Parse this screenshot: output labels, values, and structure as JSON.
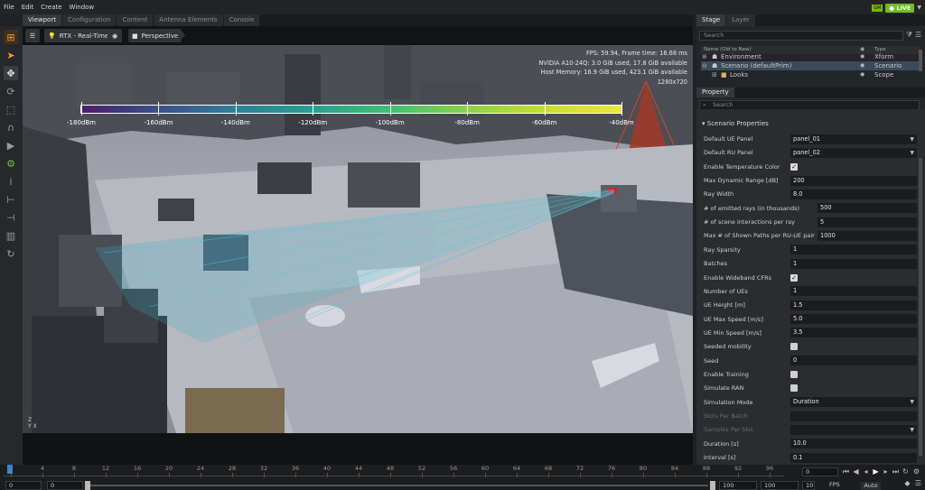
{
  "menu": [
    "File",
    "Edit",
    "Create",
    "Window"
  ],
  "live_label": "LIVE",
  "nvidia_badge": "GM",
  "viewport_tabs": [
    "Viewport",
    "Configuration",
    "Content",
    "Antenna Elements",
    "Console"
  ],
  "viewport_toolbar": {
    "renderer": "RTX - Real-Time",
    "camera": "Perspective"
  },
  "hud": {
    "line1": "FPS: 59.94, Frame time: 16.68 ms",
    "line2": "NVIDIA A10-24Q: 3.0 GiB used, 17.8 GiB available",
    "line3": "Host Memory: 16.9 GiB used, 423.1 GiB available",
    "line4": "1280x720"
  },
  "colorbar": {
    "labels": [
      "-180dBm",
      "-160dBm",
      "-140dBm",
      "-120dBm",
      "-100dBm",
      "-80dBm",
      "-60dBm",
      "-40dBm"
    ],
    "colors": [
      "#4b1d6b",
      "#3b4f8c",
      "#2e7f9a",
      "#27a08f",
      "#3fbf72",
      "#8bd24a",
      "#c9dc32",
      "#ece63a"
    ]
  },
  "axes_labels": {
    "z": "Z",
    "y": "Y",
    "x": "X"
  },
  "stage": {
    "tabs": [
      "Stage",
      "Layer"
    ],
    "search_placeholder": "Search",
    "columns": {
      "name": "Name (Old to New)",
      "type": "Type"
    },
    "rows": [
      {
        "name": "Environment",
        "type": "Xform",
        "selected": false
      },
      {
        "name": "Scenario (defaultPrim)",
        "type": "Scenario",
        "selected": true
      },
      {
        "name": "Looks",
        "type": "Scope",
        "selected": false
      }
    ]
  },
  "property": {
    "tab": "Property",
    "search_placeholder": "Search",
    "section": "Scenario Properties",
    "rows": [
      {
        "label": "Default UE Panel",
        "kind": "dropdown",
        "value": "panel_01"
      },
      {
        "label": "Default RU Panel",
        "kind": "dropdown",
        "value": "panel_02"
      },
      {
        "label": "Enable Temperature Color",
        "kind": "check",
        "value": "✓"
      },
      {
        "label": "Max Dynamic Range [dB]",
        "kind": "field",
        "value": "200"
      },
      {
        "label": "Ray Width",
        "kind": "field",
        "value": "8.0"
      },
      {
        "label": "# of emitted rays (in thousands)",
        "kind": "field",
        "value": "500"
      },
      {
        "label": "# of scene interactions per ray",
        "kind": "field",
        "value": "5"
      },
      {
        "label": "Max # of Shown Paths per RU-UE pair",
        "kind": "field",
        "value": "1000"
      },
      {
        "label": "Ray Sparsity",
        "kind": "field",
        "value": "1"
      },
      {
        "label": "Batches",
        "kind": "field",
        "value": "1"
      },
      {
        "label": "Enable Wideband CFRs",
        "kind": "check",
        "value": "✓"
      },
      {
        "label": "Number of UEs",
        "kind": "field",
        "value": "1"
      },
      {
        "label": "UE Height [m]",
        "kind": "field",
        "value": "1.5"
      },
      {
        "label": "UE Max Speed [m/s]",
        "kind": "field",
        "value": "5.0"
      },
      {
        "label": "UE Min Speed [m/s]",
        "kind": "field",
        "value": "3.5"
      },
      {
        "label": "Seeded mobility",
        "kind": "check",
        "value": ""
      },
      {
        "label": "Seed",
        "kind": "field",
        "value": "0"
      },
      {
        "label": "Enable Training",
        "kind": "check",
        "value": ""
      },
      {
        "label": "Simulate RAN",
        "kind": "check",
        "value": ""
      },
      {
        "label": "Simulation Mode",
        "kind": "dropdown",
        "value": "Duration"
      },
      {
        "label": "Slots Per Batch",
        "kind": "field",
        "value": "",
        "dim": true
      },
      {
        "label": "Samples Per Slot",
        "kind": "dropdown",
        "value": "",
        "dim": true
      },
      {
        "label": "Duration [s]",
        "kind": "field",
        "value": "10.0"
      },
      {
        "label": "Interval [s]",
        "kind": "field",
        "value": "0.1"
      }
    ]
  },
  "timeline": {
    "ticks": [
      "0",
      "4",
      "8",
      "12",
      "16",
      "20",
      "24",
      "28",
      "32",
      "36",
      "40",
      "44",
      "48",
      "52",
      "56",
      "60",
      "64",
      "68",
      "72",
      "76",
      "80",
      "84",
      "88",
      "92",
      "96"
    ],
    "frame": "0",
    "start": "0",
    "start2": "0",
    "end": "100",
    "end2": "100",
    "fps_value": "10",
    "fps_label": "FPS",
    "auto_label": "Auto"
  }
}
